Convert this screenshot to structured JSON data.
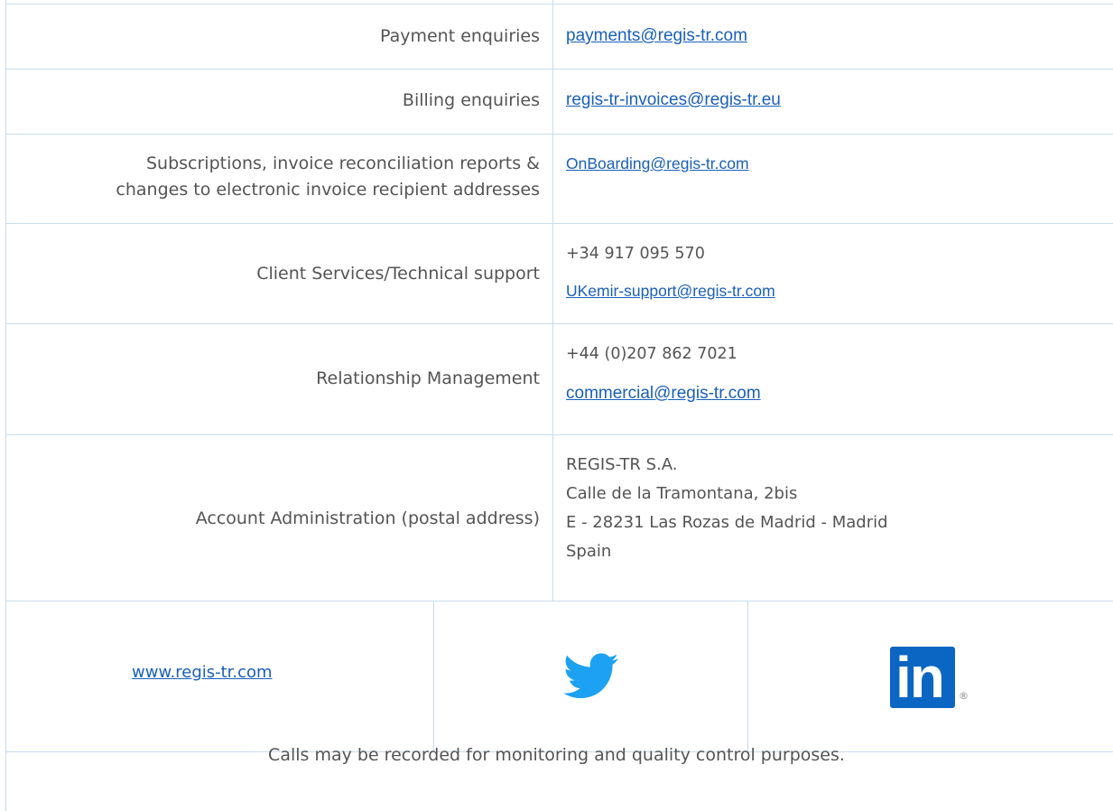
{
  "rows": [
    {
      "label": "Payment enquiries",
      "email": "payments@regis-tr.com"
    },
    {
      "label": "Billing enquiries",
      "email": "regis-tr-invoices@regis-tr.eu"
    },
    {
      "label_line1": "Subscriptions, invoice reconciliation reports &",
      "label_line2": "changes to electronic invoice recipient addresses",
      "email": "OnBoarding@regis-tr.com"
    },
    {
      "label": "Client Services/Technical support",
      "phone": "+34 917 095 570",
      "email": "UKemir-support@regis-tr.com"
    },
    {
      "label": "Relationship Management",
      "phone": "+44 (0)207 862 7021",
      "email": "commercial@regis-tr.com"
    },
    {
      "label": "Account Administration (postal address)",
      "address": [
        "REGIS-TR S.A.",
        "Calle de la Tramontana, 2bis",
        "E - 28231 Las Rozas de Madrid - Madrid",
        "Spain"
      ]
    }
  ],
  "footer": {
    "website": "www.regis-tr.com",
    "twitter_icon": "twitter-bird-icon",
    "linkedin_icon": "linkedin-icon",
    "linkedin_text": "in",
    "registered_mark": "®",
    "note": "Calls may be recorded for monitoring and quality control purposes."
  },
  "colors": {
    "border": "#c9dcec",
    "text": "#545454",
    "link": "#1a5fb8",
    "twitter": "#1da1f2",
    "linkedin": "#0a66c2"
  }
}
